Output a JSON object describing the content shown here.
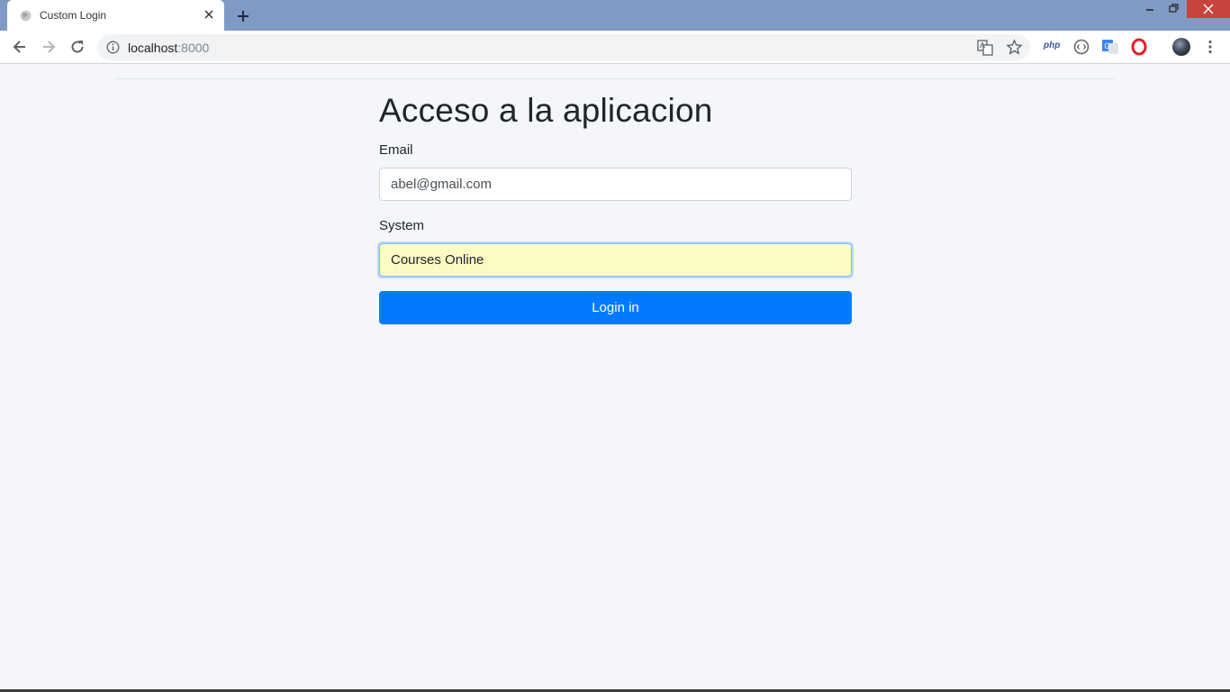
{
  "browser": {
    "tab": {
      "title": "Custom Login"
    },
    "address_bar": {
      "host": "localhost",
      "port": ":8000"
    },
    "extensions": {
      "php_label": "php"
    },
    "colors": {
      "tabstrip": "#7f9ac3",
      "close_button": "#c7433e"
    }
  },
  "page": {
    "title": "Acceso a la aplicacion",
    "email": {
      "label": "Email",
      "value": "abel@gmail.com"
    },
    "system": {
      "label": "System",
      "value": "Courses Online"
    },
    "submit_label": "Login in",
    "colors": {
      "primary": "#007bff",
      "autofill_bg": "#fbfcc4",
      "background": "#f4f6f9"
    }
  }
}
